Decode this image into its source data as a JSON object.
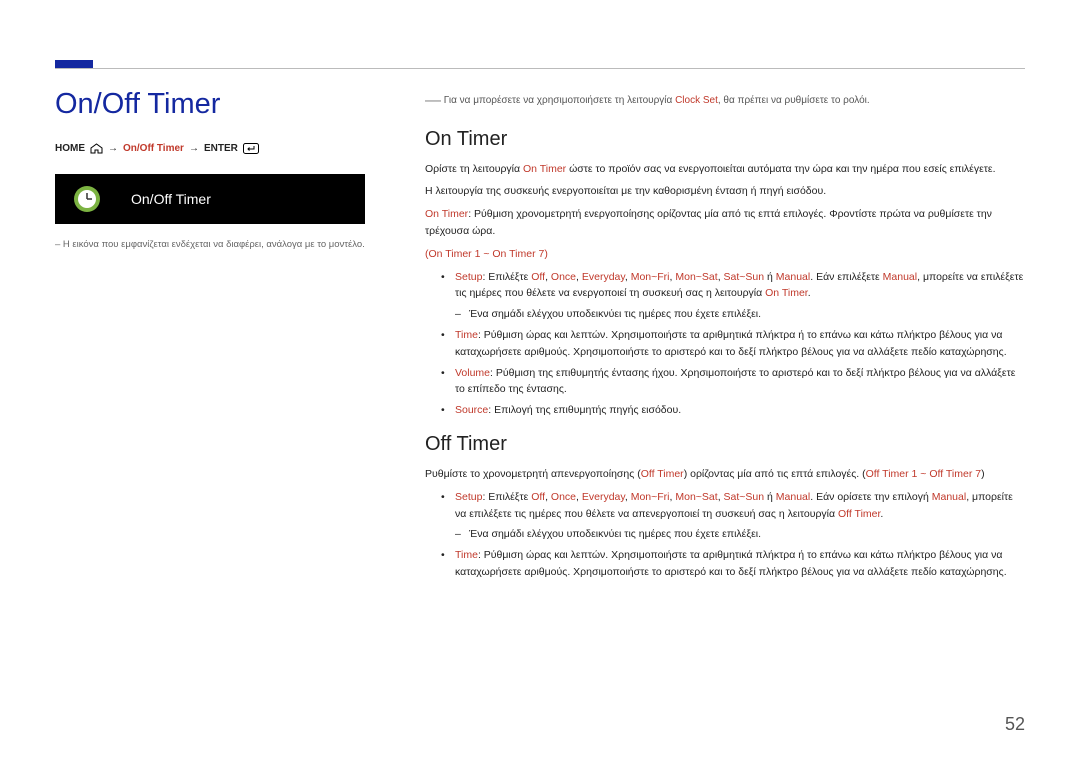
{
  "page": {
    "title": "On/Off Timer",
    "number": "52"
  },
  "breadcrumb": {
    "home": "HOME",
    "item": "On/Off Timer",
    "enter": "ENTER",
    "arrow": "→"
  },
  "screen_box": {
    "label": "On/Off Timer"
  },
  "left_note": "– Η εικόνα που εμφανίζεται ενδέχεται να διαφέρει, ανάλογα με το μοντέλο.",
  "top_note": {
    "pre": "Για να μπορέσετε να χρησιμοποιήσετε τη λειτουργία ",
    "term": "Clock Set",
    "post": ", θα πρέπει να ρυθμίσετε το ρολόι."
  },
  "on_timer": {
    "title": "On Timer",
    "p1": {
      "pre": "Ορίστε τη λειτουργία ",
      "term": "On Timer",
      "post": " ώστε το προϊόν σας να ενεργοποιείται αυτόματα την ώρα και την ημέρα που εσείς επιλέγετε."
    },
    "p2": "Η λειτουργία της συσκευής ενεργοποιείται με την καθορισμένη ένταση ή πηγή εισόδου.",
    "p3": {
      "term": "On Timer",
      "post": ": Ρύθμιση χρονομετρητή ενεργοποίησης ορίζοντας μία από τις επτά επιλογές. Φροντίστε πρώτα να ρυθμίσετε την τρέχουσα ώρα."
    },
    "range": "(On Timer 1 ~ On Timer 7)",
    "setup": {
      "label": "Setup",
      "pre": ": Επιλέξτε ",
      "opt1": "Off",
      "sep": ", ",
      "opt2": "Once",
      "opt3": "Everyday",
      "opt4": "Mon~Fri",
      "opt5": "Mon~Sat",
      "opt6": "Sat~Sun",
      "or": " ή ",
      "opt7": "Manual",
      "post1": ". Εάν επιλέξετε ",
      "term2": "Manual",
      "post2": ", μπορείτε να επιλέξετε τις ημέρες που θέλετε να ενεργοποιεί τη συσκευή σας η λειτουργία ",
      "term3": "On Timer",
      "post3": ".",
      "check_note": "Ένα σημάδι ελέγχου υποδεικνύει τις ημέρες που έχετε επιλέξει."
    },
    "time": {
      "label": "Time",
      "text": ": Ρύθμιση ώρας και λεπτών. Χρησιμοποιήστε τα αριθμητικά πλήκτρα ή το επάνω και κάτω πλήκτρο βέλους για να καταχωρήσετε αριθμούς. Χρησιμοποιήστε το αριστερό και το δεξί πλήκτρο βέλους για να αλλάξετε πεδίο καταχώρησης."
    },
    "volume": {
      "label": "Volume",
      "text": ": Ρύθμιση της επιθυμητής έντασης ήχου. Χρησιμοποιήστε το αριστερό και το δεξί πλήκτρο βέλους για να αλλάξετε το επίπεδο της έντασης."
    },
    "source": {
      "label": "Source",
      "text": ": Επιλογή της επιθυμητής πηγής εισόδου."
    }
  },
  "off_timer": {
    "title": "Off Timer",
    "p1": {
      "pre": "Ρυθμίστε το χρονομετρητή απενεργοποίησης (",
      "term1": "Off Timer",
      "mid": ") ορίζοντας μία από τις επτά επιλογές. (",
      "term2": "Off Timer 1",
      "tilde": " ~ ",
      "term3": "Off Timer 7",
      "post": ")"
    },
    "setup": {
      "label": "Setup",
      "pre": ": Επιλέξτε ",
      "opt1": "Off",
      "sep": ", ",
      "opt2": "Once",
      "opt3": "Everyday",
      "opt4": "Mon~Fri",
      "opt5": "Mon~Sat",
      "opt6": "Sat~Sun",
      "or": " ή ",
      "opt7": "Manual",
      "post1": ". Εάν ορίσετε την επιλογή ",
      "term2": "Manual",
      "post2": ", μπορείτε να επιλέξετε τις ημέρες που θέλετε να απενεργοποιεί τη συσκευή σας η λειτουργία ",
      "term3": "Off Timer",
      "post3": ".",
      "check_note": "Ένα σημάδι ελέγχου υποδεικνύει τις ημέρες που έχετε επιλέξει."
    },
    "time": {
      "label": "Time",
      "text": ": Ρύθμιση ώρας και λεπτών. Χρησιμοποιήστε τα αριθμητικά πλήκτρα ή το επάνω και κάτω πλήκτρο βέλους για να καταχωρήσετε αριθμούς. Χρησιμοποιήστε το αριστερό και το δεξί πλήκτρο βέλους για να αλλάξετε πεδίο καταχώρησης."
    }
  }
}
